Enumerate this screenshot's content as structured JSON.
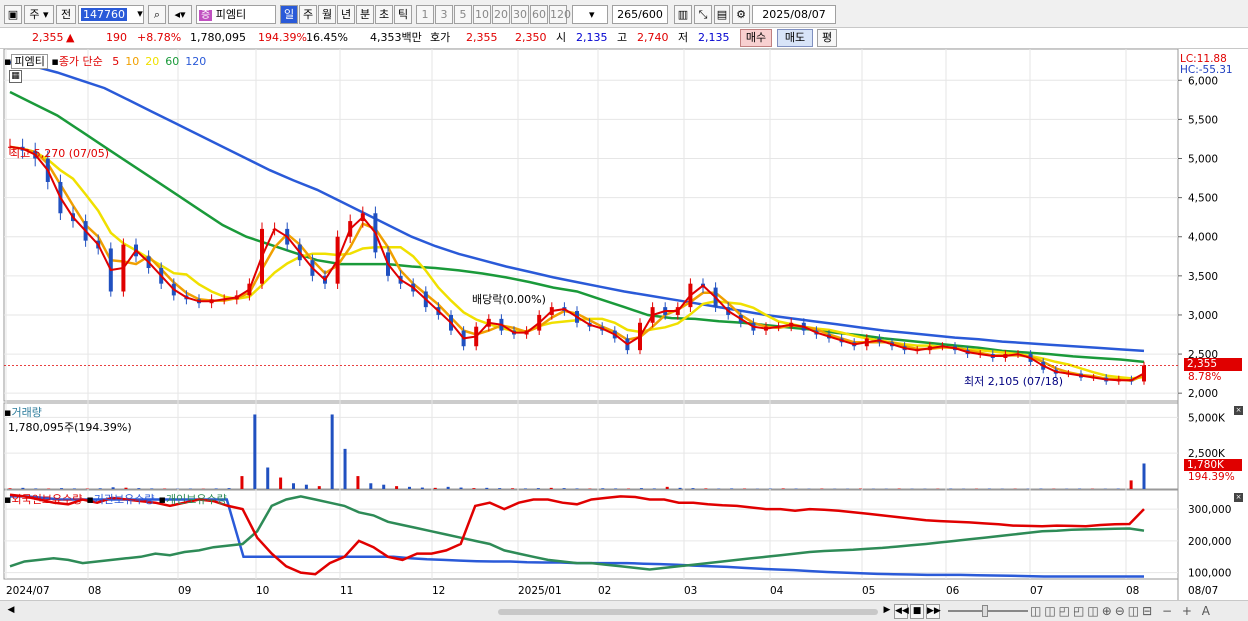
{
  "toolbar": {
    "market_type": "주",
    "compare_label": "전",
    "code": "147760",
    "stock_badge": "증",
    "stock_name": "피엠티",
    "periods": [
      "일",
      "주",
      "월",
      "년",
      "분",
      "초",
      "틱"
    ],
    "intervals": [
      "1",
      "3",
      "5",
      "10",
      "20",
      "30",
      "60",
      "120"
    ],
    "count": "265",
    "count_total": "/600",
    "date": "2025/08/07"
  },
  "quote": {
    "price": "2,355",
    "arrow": "▲",
    "change": "190",
    "change_pct": "+8.78%",
    "volume": "1,780,095",
    "volume_pct": "194.39%",
    "turnover_pct": "16.45%",
    "amount": "4,353백만",
    "ask_label": "호가",
    "ask": "2,355",
    "bid": "2,350",
    "open_label": "시",
    "open": "2,135",
    "high_label": "고",
    "high": "2,740",
    "low_label": "저",
    "low": "2,135",
    "buy_button": "매수",
    "sell_button": "매도",
    "eval_button": "평"
  },
  "price_panel": {
    "legend_name": "피엠티",
    "legend_ma_label": "종가 단순",
    "ma_periods": [
      "5",
      "10",
      "20",
      "60",
      "120"
    ],
    "ma_colors": [
      "#e00000",
      "#f0a000",
      "#f0e000",
      "#1a9a3a",
      "#2a5ad8"
    ],
    "lc_label": "LC:11.88",
    "hc_label": "HC:-55.31",
    "high_annotation": "최고 5,270 (07/05)",
    "low_annotation": "최저 2,105 (07/18)",
    "dividend_annotation": "배당락(0.00%)",
    "current_price_tag": "2,355",
    "current_pct_tag": "8.78%",
    "y_ticks": [
      "6,000",
      "5,500",
      "5,000",
      "4,500",
      "4,000",
      "3,500",
      "3,000",
      "2,500",
      "2,000"
    ]
  },
  "volume_panel": {
    "title": "거래량",
    "value": "1,780,095주(194.39%)",
    "y_ticks": [
      "5,000K",
      "2,500K"
    ],
    "current_tag": "1,780K",
    "current_pct": "194.39%"
  },
  "holding_panel": {
    "series": [
      {
        "name": "외국인보유수량",
        "color": "#e00000"
      },
      {
        "name": "기관보유수량",
        "color": "#2a5ad8"
      },
      {
        "name": "개인보유수량",
        "color": "#2e8b57"
      }
    ],
    "y_ticks": [
      "300,000",
      "200,000",
      "100,000"
    ]
  },
  "x_axis": {
    "labels": [
      "2024/07",
      "08",
      "09",
      "10",
      "11",
      "12",
      "2025/01",
      "02",
      "03",
      "04",
      "05",
      "06",
      "07",
      "08"
    ],
    "end_label": "08/07"
  },
  "chart_data": {
    "type": "line",
    "note_price_range": [
      2000,
      6200
    ],
    "ylim_price": [
      1900,
      6400
    ],
    "ylim_volume": [
      0,
      6000
    ],
    "ylim_holding": [
      80000,
      360000
    ],
    "close": [
      5150,
      5100,
      5000,
      4700,
      4300,
      4200,
      3950,
      3850,
      3300,
      3900,
      3750,
      3600,
      3400,
      3250,
      3200,
      3150,
      3200,
      3200,
      3250,
      3400,
      4100,
      4100,
      3900,
      3700,
      3500,
      3400,
      4000,
      4200,
      4300,
      3800,
      3500,
      3400,
      3300,
      3100,
      3000,
      2800,
      2600,
      2850,
      2950,
      2800,
      2750,
      2800,
      3000,
      3100,
      3050,
      2900,
      2850,
      2800,
      2700,
      2550,
      2900,
      3100,
      3000,
      3100,
      3400,
      3350,
      3100,
      3000,
      2900,
      2800,
      2850,
      2850,
      2900,
      2800,
      2750,
      2700,
      2650,
      2600,
      2700,
      2650,
      2600,
      2550,
      2550,
      2600,
      2600,
      2550,
      2500,
      2500,
      2450,
      2500,
      2500,
      2400,
      2300,
      2250,
      2250,
      2200,
      2200,
      2150,
      2180,
      2150,
      2355
    ],
    "ma120": [
      6230,
      6180,
      6100,
      6000,
      5900,
      5750,
      5600,
      5450,
      5300,
      5150,
      5000,
      4850,
      4720,
      4600,
      4450,
      4300,
      4150,
      4000,
      3880,
      3780,
      3700,
      3620,
      3550,
      3480,
      3420,
      3360,
      3300,
      3250,
      3200,
      3150,
      3100,
      3050,
      3000,
      2960,
      2920,
      2880,
      2840,
      2800,
      2770,
      2740,
      2710,
      2690,
      2660,
      2640,
      2620,
      2600,
      2580,
      2560,
      2540
    ],
    "ma60": [
      5850,
      5700,
      5550,
      5350,
      5150,
      4950,
      4750,
      4550,
      4350,
      4150,
      4000,
      3900,
      3800,
      3700,
      3650,
      3650,
      3650,
      3620,
      3600,
      3570,
      3530,
      3480,
      3420,
      3350,
      3300,
      3200,
      3100,
      3000,
      2960,
      2950,
      2920,
      2900,
      2870,
      2840,
      2810,
      2770,
      2740,
      2700,
      2670,
      2640,
      2610,
      2580,
      2540,
      2520,
      2500,
      2470,
      2450,
      2430,
      2400
    ],
    "volume": [
      50,
      80,
      40,
      30,
      60,
      40,
      30,
      50,
      120,
      90,
      60,
      40,
      30,
      20,
      30,
      20,
      40,
      60,
      900,
      5200,
      1500,
      800,
      400,
      300,
      200,
      5200,
      2800,
      900,
      400,
      300,
      200,
      150,
      100,
      80,
      150,
      100,
      60,
      80,
      60,
      50,
      40,
      60,
      80,
      60,
      40,
      30,
      50,
      40,
      30,
      60,
      40,
      150,
      80,
      60,
      40,
      30,
      40,
      30,
      20,
      30,
      40,
      30,
      20,
      30,
      20,
      20,
      30,
      20,
      20,
      30,
      20,
      20,
      20,
      30,
      20,
      20,
      30,
      20,
      20,
      20,
      30,
      20,
      20,
      30,
      20,
      20,
      30,
      600,
      1780
    ],
    "foreign": [
      345,
      340,
      330,
      320,
      315,
      330,
      320,
      335,
      330,
      325,
      320,
      310,
      320,
      330,
      325,
      310,
      300,
      210,
      160,
      120,
      100,
      95,
      130,
      150,
      200,
      180,
      150,
      140,
      160,
      160,
      170,
      190,
      310,
      320,
      300,
      320,
      330,
      330,
      320,
      315,
      330,
      335,
      340,
      338,
      330,
      330,
      320,
      320,
      315,
      312,
      310,
      305,
      300,
      300,
      295,
      300,
      298,
      295,
      290,
      285,
      280,
      275,
      270,
      265,
      262,
      260,
      258,
      255,
      252,
      248,
      247,
      246,
      248,
      247,
      246,
      250,
      252,
      253,
      300
    ],
    "institution": [
      340,
      340,
      335,
      330,
      330,
      330,
      330,
      330,
      330,
      330,
      330,
      330,
      330,
      330,
      150,
      150,
      150,
      150,
      150,
      150,
      150,
      150,
      150,
      150,
      145,
      142,
      140,
      138,
      136,
      135,
      135,
      133,
      132,
      132,
      130,
      130,
      130,
      130,
      128,
      127,
      125,
      122,
      120,
      118,
      115,
      112,
      110,
      108,
      105,
      102,
      100,
      98,
      96,
      95,
      94,
      93,
      93,
      93,
      92,
      91,
      90,
      89,
      88,
      88,
      88,
      88,
      88,
      88,
      88
    ],
    "individual": [
      120,
      135,
      140,
      145,
      140,
      130,
      135,
      140,
      145,
      150,
      160,
      155,
      165,
      170,
      180,
      185,
      190,
      230,
      310,
      330,
      340,
      330,
      320,
      310,
      290,
      280,
      260,
      250,
      240,
      230,
      220,
      210,
      200,
      190,
      170,
      160,
      150,
      140,
      135,
      130,
      130,
      125,
      120,
      115,
      110,
      115,
      120,
      125,
      130,
      135,
      140,
      145,
      150,
      155,
      160,
      165,
      168,
      170,
      172,
      175,
      178,
      182,
      186,
      190,
      195,
      200,
      205,
      210,
      215,
      220,
      225,
      230,
      232,
      235,
      236,
      237,
      238,
      239,
      232
    ]
  }
}
